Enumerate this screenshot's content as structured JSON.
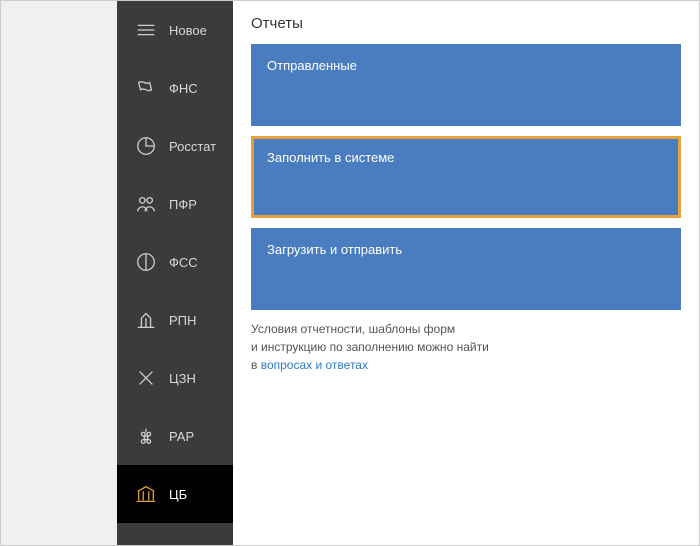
{
  "sidebar": {
    "items": [
      {
        "label": "Новое"
      },
      {
        "label": "ФНС"
      },
      {
        "label": "Росстат"
      },
      {
        "label": "ПФР"
      },
      {
        "label": "ФСС"
      },
      {
        "label": "РПН"
      },
      {
        "label": "ЦЗН"
      },
      {
        "label": "РАР"
      },
      {
        "label": "ЦБ"
      }
    ]
  },
  "main": {
    "title": "Отчеты",
    "tiles": [
      {
        "label": "Отправленные"
      },
      {
        "label": "Заполнить в системе"
      },
      {
        "label": "Загрузить и отправить"
      }
    ],
    "hint": {
      "line1": "Условия отчетности, шаблоны форм",
      "line2_prefix": "и инструкцию по заполнению можно найти",
      "line3_prefix": "в ",
      "link": "вопросах и ответах"
    }
  }
}
